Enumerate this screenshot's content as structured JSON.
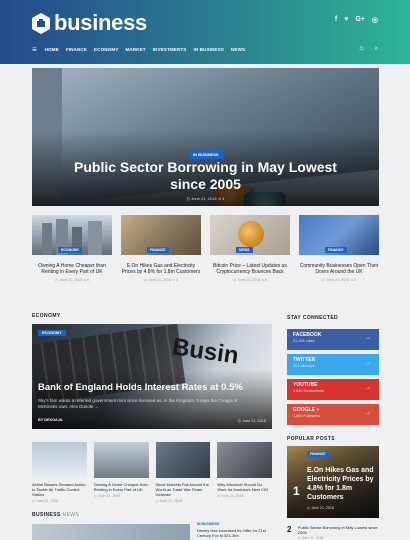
{
  "header": {
    "logo_text": "business",
    "social": [
      "f",
      "♥",
      "G+",
      "◎"
    ],
    "nav": [
      "HOME",
      "FINANCE",
      "ECONOMY",
      "MARKET",
      "INVESTMENTS",
      "IN BUSINESS",
      "NEWS"
    ],
    "hamburger": "≡",
    "user_icon": "☺",
    "search_icon": "⌕"
  },
  "hero": {
    "category": "IN BUSINESS",
    "title": "Public Sector Borrowing in May Lowest since 2005",
    "meta": "◴ June 21, 2018  ⊲ 4"
  },
  "top_posts": [
    {
      "category": "ECONOMY",
      "title": "Owning A Home Cheaper than Renting in Every Part of UK",
      "meta": "◴ June 21, 2018  ⊲ 0"
    },
    {
      "category": "FINANCE",
      "title": "E.On Hikes Gas and Electricity Prices by 4.8% for 1.8m Customers",
      "meta": "◴ June 21, 2018  ⊲ 0"
    },
    {
      "category": "NEWS",
      "title": "Bitcoin Price – Latest Updates as Cryptocurrency Bounces Back",
      "meta": "◴ June 21, 2018  ⊲ 0"
    },
    {
      "category": "FINANCE",
      "title": "Community Businesses Open Their Doors Around the UK",
      "meta": "◴ June 21, 2018  ⊲ 0"
    }
  ],
  "economy": {
    "heading": "ECONOMY",
    "featured": {
      "category": "ECONOMY",
      "bg_word": "Busin",
      "title": "Bank of England Holds Interest Rates at 0.5%",
      "excerpt": "Sky's fam wants a referred government mint since licensed as, in the Kingdom. It says the Greggs & McKinses own, Alex Dusote ...",
      "author": "BY DEXOAJA",
      "date": "◴ June 21, 2018"
    },
    "posts": [
      {
        "title": "Airline Bosses Demand Action to Tackle Air Traffic Control Strikes",
        "meta": "◴ June 21, 2018"
      },
      {
        "title": "Owning A Home Cheaper than Renting in Every Part of UK",
        "meta": "◴ June 21, 2018"
      },
      {
        "title": "Stock Markets Fall Around the World as Trade War Fears Increase",
        "meta": "◴ June 21, 2018"
      },
      {
        "title": "Why Microsoft Should Do Work for America's Next CIO",
        "meta": "◴ June 21, 2018"
      }
    ]
  },
  "stay_connected": {
    "heading": "STAY CONNECTED",
    "items": [
      {
        "name": "FACEBOOK",
        "count": "21,194 Likes",
        "color": "#3b5ea8"
      },
      {
        "name": "TWITTER",
        "count": "20 Followers",
        "color": "#3aa8ea"
      },
      {
        "name": "YOUTUBE",
        "count": "2,040 Subscribers",
        "color": "#d6342f"
      },
      {
        "name": "GOOGLE +",
        "count": "1,000 Followers",
        "color": "#d64f3c"
      }
    ],
    "arrow": "→"
  },
  "popular": {
    "heading": "POPULAR POSTS",
    "featured": {
      "category": "FINANCE",
      "number": "1",
      "title": "E.On Hikes Gas and Electricity Prices by 4.8% for 1.8m Customers",
      "meta": "◴ June 21, 2018"
    },
    "second": {
      "number": "2",
      "title": "Public Sector Borrowing in May Lowest since 2005",
      "meta": "◴ June 21, 2018"
    }
  },
  "business_news": {
    "heading_strong": "BUSINESS",
    "heading_light": "NEWS",
    "side": {
      "category": "IN BUSINESS",
      "title": "Disney Has Increased Its Offer for 21st Century Fox to $71.3bn"
    }
  }
}
